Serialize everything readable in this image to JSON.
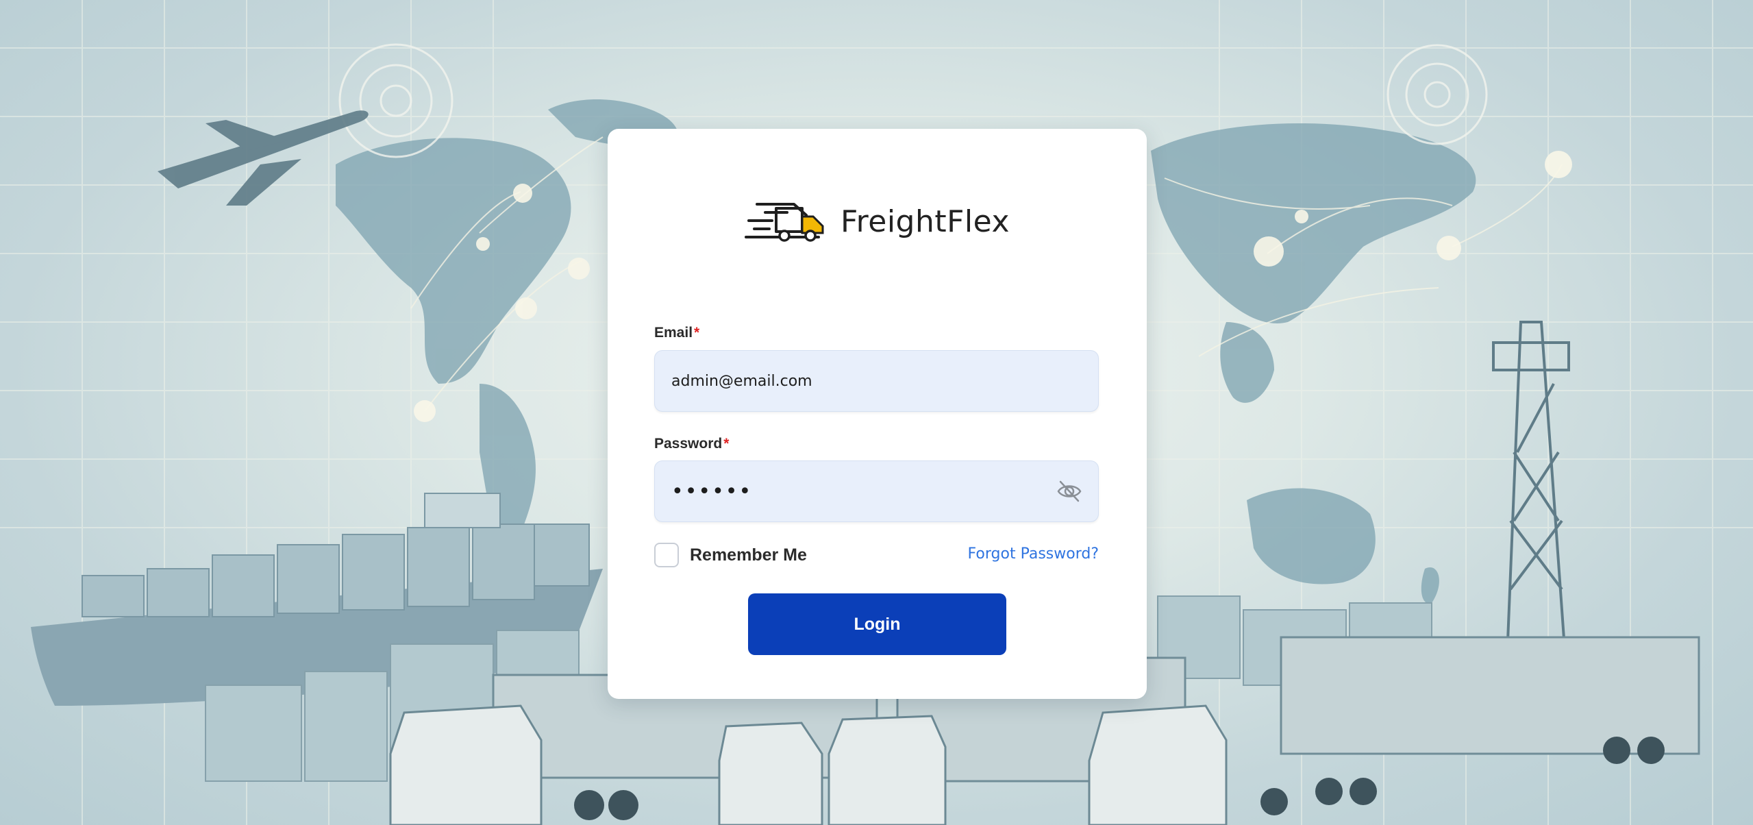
{
  "brand": {
    "name": "FreightFlex",
    "logo_icon": "truck-logo-icon"
  },
  "form": {
    "email": {
      "label": "Email",
      "required_mark": "*",
      "value": "admin@email.com"
    },
    "password": {
      "label": "Password",
      "required_mark": "*",
      "masked_value": "••••••",
      "toggle_icon": "eye-off-icon"
    },
    "remember_label": "Remember Me",
    "remember_checked": false,
    "forgot_link": "Forgot Password?",
    "login_button": "Login"
  },
  "colors": {
    "primary": "#0b3fb8",
    "link": "#2f74e0",
    "input_bg": "#e8effb",
    "required": "#e02424",
    "logo_accent": "#f2b705"
  }
}
